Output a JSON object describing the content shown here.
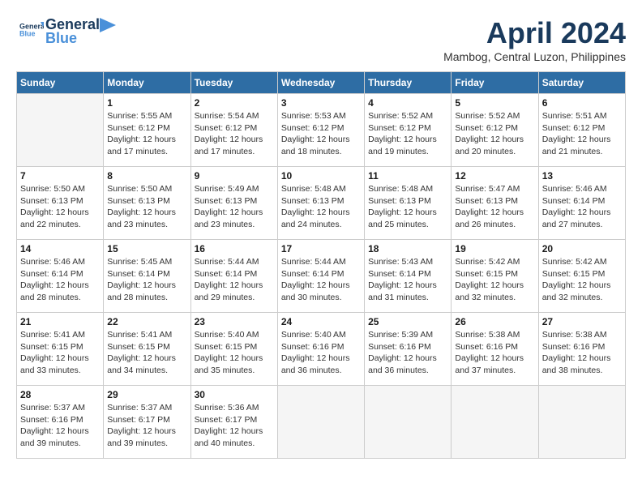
{
  "header": {
    "logo_line1": "General",
    "logo_line2": "Blue",
    "month_title": "April 2024",
    "location": "Mambog, Central Luzon, Philippines"
  },
  "weekdays": [
    "Sunday",
    "Monday",
    "Tuesday",
    "Wednesday",
    "Thursday",
    "Friday",
    "Saturday"
  ],
  "weeks": [
    [
      {
        "day": "",
        "info": ""
      },
      {
        "day": "1",
        "info": "Sunrise: 5:55 AM\nSunset: 6:12 PM\nDaylight: 12 hours\nand 17 minutes."
      },
      {
        "day": "2",
        "info": "Sunrise: 5:54 AM\nSunset: 6:12 PM\nDaylight: 12 hours\nand 17 minutes."
      },
      {
        "day": "3",
        "info": "Sunrise: 5:53 AM\nSunset: 6:12 PM\nDaylight: 12 hours\nand 18 minutes."
      },
      {
        "day": "4",
        "info": "Sunrise: 5:52 AM\nSunset: 6:12 PM\nDaylight: 12 hours\nand 19 minutes."
      },
      {
        "day": "5",
        "info": "Sunrise: 5:52 AM\nSunset: 6:12 PM\nDaylight: 12 hours\nand 20 minutes."
      },
      {
        "day": "6",
        "info": "Sunrise: 5:51 AM\nSunset: 6:12 PM\nDaylight: 12 hours\nand 21 minutes."
      }
    ],
    [
      {
        "day": "7",
        "info": "Sunrise: 5:50 AM\nSunset: 6:13 PM\nDaylight: 12 hours\nand 22 minutes."
      },
      {
        "day": "8",
        "info": "Sunrise: 5:50 AM\nSunset: 6:13 PM\nDaylight: 12 hours\nand 23 minutes."
      },
      {
        "day": "9",
        "info": "Sunrise: 5:49 AM\nSunset: 6:13 PM\nDaylight: 12 hours\nand 23 minutes."
      },
      {
        "day": "10",
        "info": "Sunrise: 5:48 AM\nSunset: 6:13 PM\nDaylight: 12 hours\nand 24 minutes."
      },
      {
        "day": "11",
        "info": "Sunrise: 5:48 AM\nSunset: 6:13 PM\nDaylight: 12 hours\nand 25 minutes."
      },
      {
        "day": "12",
        "info": "Sunrise: 5:47 AM\nSunset: 6:13 PM\nDaylight: 12 hours\nand 26 minutes."
      },
      {
        "day": "13",
        "info": "Sunrise: 5:46 AM\nSunset: 6:14 PM\nDaylight: 12 hours\nand 27 minutes."
      }
    ],
    [
      {
        "day": "14",
        "info": "Sunrise: 5:46 AM\nSunset: 6:14 PM\nDaylight: 12 hours\nand 28 minutes."
      },
      {
        "day": "15",
        "info": "Sunrise: 5:45 AM\nSunset: 6:14 PM\nDaylight: 12 hours\nand 28 minutes."
      },
      {
        "day": "16",
        "info": "Sunrise: 5:44 AM\nSunset: 6:14 PM\nDaylight: 12 hours\nand 29 minutes."
      },
      {
        "day": "17",
        "info": "Sunrise: 5:44 AM\nSunset: 6:14 PM\nDaylight: 12 hours\nand 30 minutes."
      },
      {
        "day": "18",
        "info": "Sunrise: 5:43 AM\nSunset: 6:14 PM\nDaylight: 12 hours\nand 31 minutes."
      },
      {
        "day": "19",
        "info": "Sunrise: 5:42 AM\nSunset: 6:15 PM\nDaylight: 12 hours\nand 32 minutes."
      },
      {
        "day": "20",
        "info": "Sunrise: 5:42 AM\nSunset: 6:15 PM\nDaylight: 12 hours\nand 32 minutes."
      }
    ],
    [
      {
        "day": "21",
        "info": "Sunrise: 5:41 AM\nSunset: 6:15 PM\nDaylight: 12 hours\nand 33 minutes."
      },
      {
        "day": "22",
        "info": "Sunrise: 5:41 AM\nSunset: 6:15 PM\nDaylight: 12 hours\nand 34 minutes."
      },
      {
        "day": "23",
        "info": "Sunrise: 5:40 AM\nSunset: 6:15 PM\nDaylight: 12 hours\nand 35 minutes."
      },
      {
        "day": "24",
        "info": "Sunrise: 5:40 AM\nSunset: 6:16 PM\nDaylight: 12 hours\nand 36 minutes."
      },
      {
        "day": "25",
        "info": "Sunrise: 5:39 AM\nSunset: 6:16 PM\nDaylight: 12 hours\nand 36 minutes."
      },
      {
        "day": "26",
        "info": "Sunrise: 5:38 AM\nSunset: 6:16 PM\nDaylight: 12 hours\nand 37 minutes."
      },
      {
        "day": "27",
        "info": "Sunrise: 5:38 AM\nSunset: 6:16 PM\nDaylight: 12 hours\nand 38 minutes."
      }
    ],
    [
      {
        "day": "28",
        "info": "Sunrise: 5:37 AM\nSunset: 6:16 PM\nDaylight: 12 hours\nand 39 minutes."
      },
      {
        "day": "29",
        "info": "Sunrise: 5:37 AM\nSunset: 6:17 PM\nDaylight: 12 hours\nand 39 minutes."
      },
      {
        "day": "30",
        "info": "Sunrise: 5:36 AM\nSunset: 6:17 PM\nDaylight: 12 hours\nand 40 minutes."
      },
      {
        "day": "",
        "info": ""
      },
      {
        "day": "",
        "info": ""
      },
      {
        "day": "",
        "info": ""
      },
      {
        "day": "",
        "info": ""
      }
    ]
  ]
}
